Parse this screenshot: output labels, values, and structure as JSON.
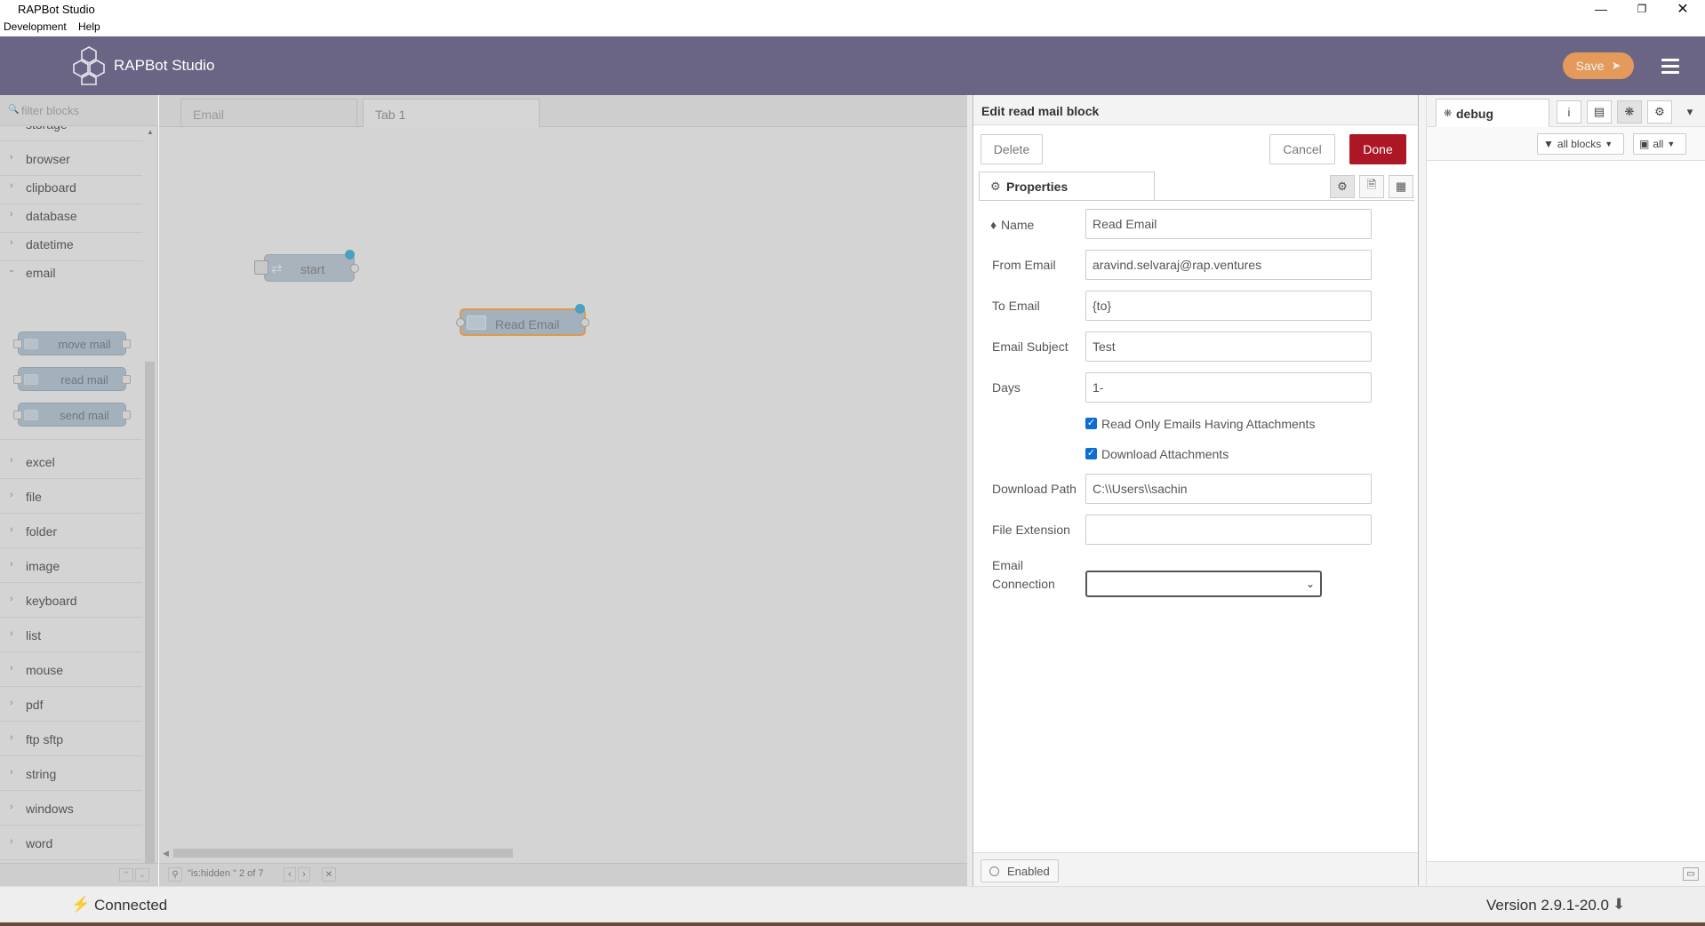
{
  "window": {
    "title": "RAPBot Studio",
    "menu": [
      "Development",
      "Help"
    ],
    "controls": [
      "minimize-icon",
      "restore-icon",
      "close-icon"
    ]
  },
  "header": {
    "app_name": "RAPBot Studio",
    "save_label": "Save",
    "accent": "#f2a057",
    "bar_color": "#6a6585"
  },
  "palette": {
    "filter_placeholder": "filter blocks",
    "partial_top_label": "storage",
    "categories_before": [
      "browser",
      "clipboard",
      "database",
      "datetime"
    ],
    "open_category": "email",
    "email_nodes": [
      "move mail",
      "read mail",
      "send mail"
    ],
    "categories_after": [
      "excel",
      "file",
      "folder",
      "image",
      "keyboard",
      "list",
      "mouse",
      "pdf",
      "ftp sftp",
      "string",
      "windows",
      "word"
    ]
  },
  "workspace": {
    "tabs": [
      "Email",
      "Tab 1"
    ],
    "active_tab": "Tab 1",
    "nodes": [
      "start",
      "Read Email"
    ],
    "footer_search": "\"is:hidden \" 2 of 7"
  },
  "tray": {
    "title": "Edit read mail block",
    "delete_label": "Delete",
    "cancel_label": "Cancel",
    "done_label": "Done",
    "done_color": "#ad1625",
    "properties_tab": "Properties",
    "fields": {
      "name": {
        "label": "Name",
        "value": "Read Email"
      },
      "from_email": {
        "label": "From Email",
        "value": "aravind.selvaraj@rap.ventures"
      },
      "to_email": {
        "label": "To Email",
        "value": "{to}"
      },
      "email_subject": {
        "label": "Email Subject",
        "value": "Test"
      },
      "days": {
        "label": "Days",
        "value": "1-"
      },
      "download_path": {
        "label": "Download Path",
        "value": "C:\\\\Users\\\\sachin"
      },
      "file_extension": {
        "label": "File Extension",
        "value": ""
      },
      "email_connection": {
        "label_line1": "Email",
        "label_line2": "Connection",
        "value": ""
      }
    },
    "checkboxes": {
      "read_only_attachments": {
        "label": "Read Only Emails Having Attachments",
        "checked": true
      },
      "download_attachments": {
        "label": "Download Attachments",
        "checked": true
      }
    },
    "enabled_label": "Enabled"
  },
  "sidebar": {
    "tab": "debug",
    "filter_all_blocks": "all blocks",
    "clear_all": "all"
  },
  "status": {
    "connection": "Connected",
    "version": "Version 2.9.1-20.0"
  }
}
